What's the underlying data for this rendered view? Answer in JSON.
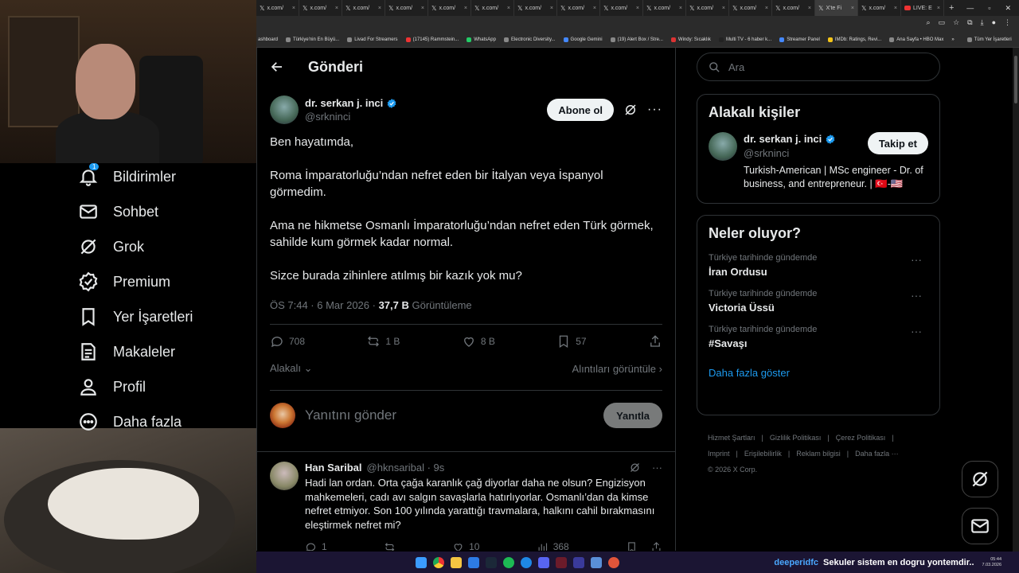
{
  "browser": {
    "tabs": [
      {
        "label": "x.com/"
      },
      {
        "label": "x.com/"
      },
      {
        "label": "x.com/"
      },
      {
        "label": "x.com/"
      },
      {
        "label": "x.com/"
      },
      {
        "label": "x.com/"
      },
      {
        "label": "x.com/"
      },
      {
        "label": "x.com/"
      },
      {
        "label": "x.com/"
      },
      {
        "label": "x.com/"
      },
      {
        "label": "x.com/"
      },
      {
        "label": "x.com/"
      },
      {
        "label": "x.com/"
      },
      {
        "label": "X'te Fi"
      },
      {
        "label": "x.com/"
      },
      {
        "label": "LIVE: E"
      }
    ],
    "bookmarks": [
      "ashboard",
      "Türkiye'nin En Büyü...",
      "Livad For Streamers",
      "(17145) Rammstein...",
      "WhatsApp",
      "Electronic Diversity...",
      "Google Gemini",
      "(19) Alert Box / Stre...",
      "Windy: Sıcaklık",
      "Multi TV - 6 haber k...",
      "Streamer Panel",
      "IMDb: Ratings, Revi...",
      "Ana Sayfa • HBO Max",
      "»",
      "Tüm Yer İşaretleri"
    ]
  },
  "nav": {
    "items": [
      {
        "label": "Bildirimler",
        "icon": "bell-icon",
        "badge": "1"
      },
      {
        "label": "Sohbet",
        "icon": "mail-icon"
      },
      {
        "label": "Grok",
        "icon": "grok-icon"
      },
      {
        "label": "Premium",
        "icon": "verified-icon"
      },
      {
        "label": "Yer İşaretleri",
        "icon": "bookmark-icon"
      },
      {
        "label": "Makaleler",
        "icon": "article-icon"
      },
      {
        "label": "Profil",
        "icon": "person-icon"
      },
      {
        "label": "Daha fazla",
        "icon": "more-circle-icon"
      }
    ]
  },
  "main": {
    "title": "Gönderi",
    "post": {
      "author_name": "dr. serkan j. inci",
      "handle": "@srkninci",
      "follow_label": "Abone ol",
      "paragraphs": [
        "Ben hayatımda,",
        "Roma İmparatorluğu’ndan nefret eden bir İtalyan veya İspanyol görmedim.",
        "Ama ne hikmetse Osmanlı İmparatorluğu’ndan nefret eden Türk görmek, sahilde kum görmek kadar normal.",
        "Sizce burada zihinlere atılmış bir kazık yok mu?"
      ],
      "time": "ÖS 7:44 · 6 Mar 2026 ·",
      "views": "37,7 B",
      "views_label": "Görüntüleme",
      "replies": "708",
      "reposts": "1 B",
      "likes": "8 B",
      "bookmarks": "57",
      "relevance": "Alakalı",
      "quotes_label": "Alıntıları görüntüle"
    },
    "reply_box": {
      "placeholder": "Yanıtını gönder",
      "button": "Yanıtla"
    },
    "reply": {
      "name": "Han Saribal",
      "handle": "@hknsaribal · 9s",
      "text": "Hadi lan ordan. Orta çağa karanlık çağ diyorlar daha ne olsun? Engizisyon mahkemeleri, cadı avı salgın savaşlarla hatırlıyorlar. Osmanlı’dan da kimse nefret etmiyor. Son 100 yılında yarattığı travmalara, halkını cahil bırakmasını eleştirmek nefret mi?",
      "replies": "1",
      "likes": "10",
      "views": "368"
    }
  },
  "sidebar": {
    "search_placeholder": "Ara",
    "related_title": "Alakalı kişiler",
    "related": {
      "name": "dr. serkan j. inci",
      "handle": "@srkninci",
      "follow": "Takip et",
      "bio": "Turkish-American | MSc engineer - Dr. of business, and entrepreneur. | 🇹🇷-🇺🇸"
    },
    "trends_title": "Neler oluyor?",
    "trends": [
      {
        "context": "Türkiye tarihinde gündemde",
        "name": "İran Ordusu"
      },
      {
        "context": "Türkiye tarihinde gündemde",
        "name": "Victoria Üssü"
      },
      {
        "context": "Türkiye tarihinde gündemde",
        "name": "#Savaşı"
      }
    ],
    "show_more": "Daha fazla göster",
    "footer": {
      "links_1": [
        "Hizmet Şartları",
        "Gizlilik Politikası",
        "Çerez Politikası"
      ],
      "links_2": [
        "Imprint",
        "Erişilebilirlik",
        "Reklam bilgisi",
        "Daha fazla ···"
      ],
      "copyright": "© 2026 X Corp."
    }
  },
  "taskbar": {
    "stream_user": "deeperidfc",
    "stream_title": "Sekuler sistem en dogru yontemdir..",
    "clock_time": "05:44",
    "clock_date": "7.03.2026"
  },
  "colors": {
    "accent": "#1d9bf0",
    "background": "#000000",
    "border": "#2f3336",
    "muted": "#71767b"
  }
}
